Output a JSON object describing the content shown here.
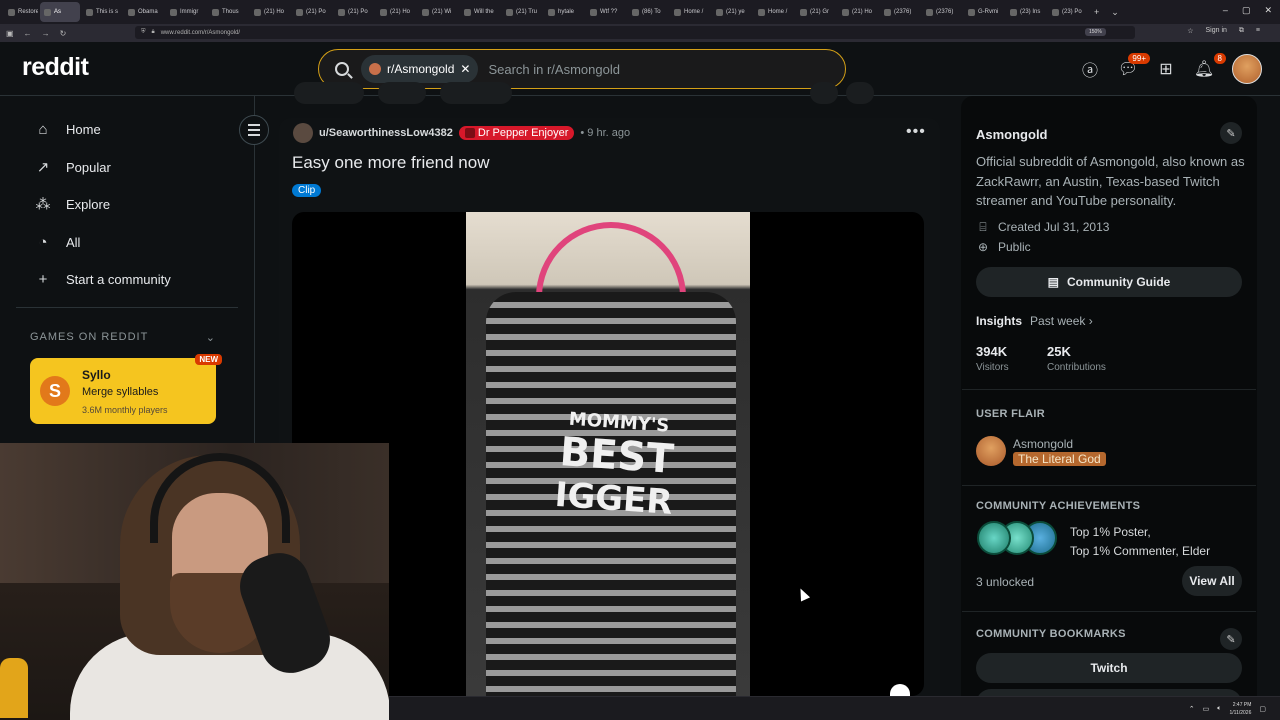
{
  "browser": {
    "tabs": [
      "Restore",
      "As",
      "This is s",
      "Obama",
      "Immigr",
      "Thous",
      "(21) Ho",
      "(21) Po",
      "(21) Po",
      "(21) Ho",
      "(21) Wi",
      "Will the",
      "(21) Tru",
      "hytale",
      "Wtf ??",
      "(86) To",
      "Home /",
      "(21) ye",
      "Home /",
      "(21) Gr",
      "(21) Ho",
      "(2376)",
      "(2376)",
      "G-Rvmi",
      "(23) Ins",
      "(23) Po"
    ],
    "url": "www.reddit.com/r/Asmongold/",
    "zoom": "150%",
    "sign_in": "Sign in",
    "new_tab_symbol": "+",
    "tab_list_symbol": "⌄",
    "window_controls": [
      "–",
      "▢",
      "✕"
    ]
  },
  "header": {
    "logo": "reddit",
    "search_chip": "r/Asmongold",
    "search_placeholder": "Search in r/Asmongold",
    "messages_badge": "99+",
    "notifications_badge": "8"
  },
  "sidebar": {
    "items": [
      {
        "label": "Home",
        "icon": "home-icon"
      },
      {
        "label": "Popular",
        "icon": "popular-icon"
      },
      {
        "label": "Explore",
        "icon": "explore-icon"
      },
      {
        "label": "All",
        "icon": "all-icon"
      },
      {
        "label": "Start a community",
        "icon": "plus-icon"
      }
    ],
    "games_heading": "GAMES ON REDDIT",
    "game": {
      "title": "Syllo",
      "subtitle": "Merge syllables",
      "players": "3.6M monthly players",
      "badge": "NEW",
      "logo_letter": "S"
    }
  },
  "post": {
    "author": "u/SeaworthinessLow4382",
    "user_flair": "Dr Pepper Enjoyer",
    "time": "• 9 hr. ago",
    "title": "Easy one more friend now",
    "post_flair": "Clip",
    "shirt_text": [
      "MOMMY'S",
      "BEST",
      "IGGER"
    ]
  },
  "community": {
    "name": "Asmongold",
    "description": "Official subreddit of Asmongold, also known as ZackRawrr, an Austin, Texas-based Twitch streamer and YouTube personality.",
    "created": "Created Jul 31, 2013",
    "visibility": "Public",
    "guide_button": "Community Guide",
    "insights_label": "Insights",
    "insights_range": "Past week ›",
    "stats": [
      {
        "value": "394K",
        "label": "Visitors"
      },
      {
        "value": "25K",
        "label": "Contributions"
      }
    ],
    "user_flair_heading": "USER FLAIR",
    "flair_user": "Asmongold",
    "flair_text": "The Literal God",
    "achievements_heading": "COMMUNITY ACHIEVEMENTS",
    "achievements_line1": "Top 1% Poster,",
    "achievements_line2": "Top 1% Commenter, Elder",
    "unlocked": "3 unlocked",
    "view_all": "View All",
    "bookmarks_heading": "COMMUNITY BOOKMARKS",
    "bookmark_1": "Twitch"
  },
  "taskbar": {
    "time": "2:47 PM",
    "date": "1/11/2026"
  },
  "colors": {
    "accent_orange": "#d93a00",
    "search_border": "#d4a017",
    "flair_red": "#d7182a",
    "clip_blue": "#0079d3",
    "game_yellow": "#f5c51f"
  }
}
